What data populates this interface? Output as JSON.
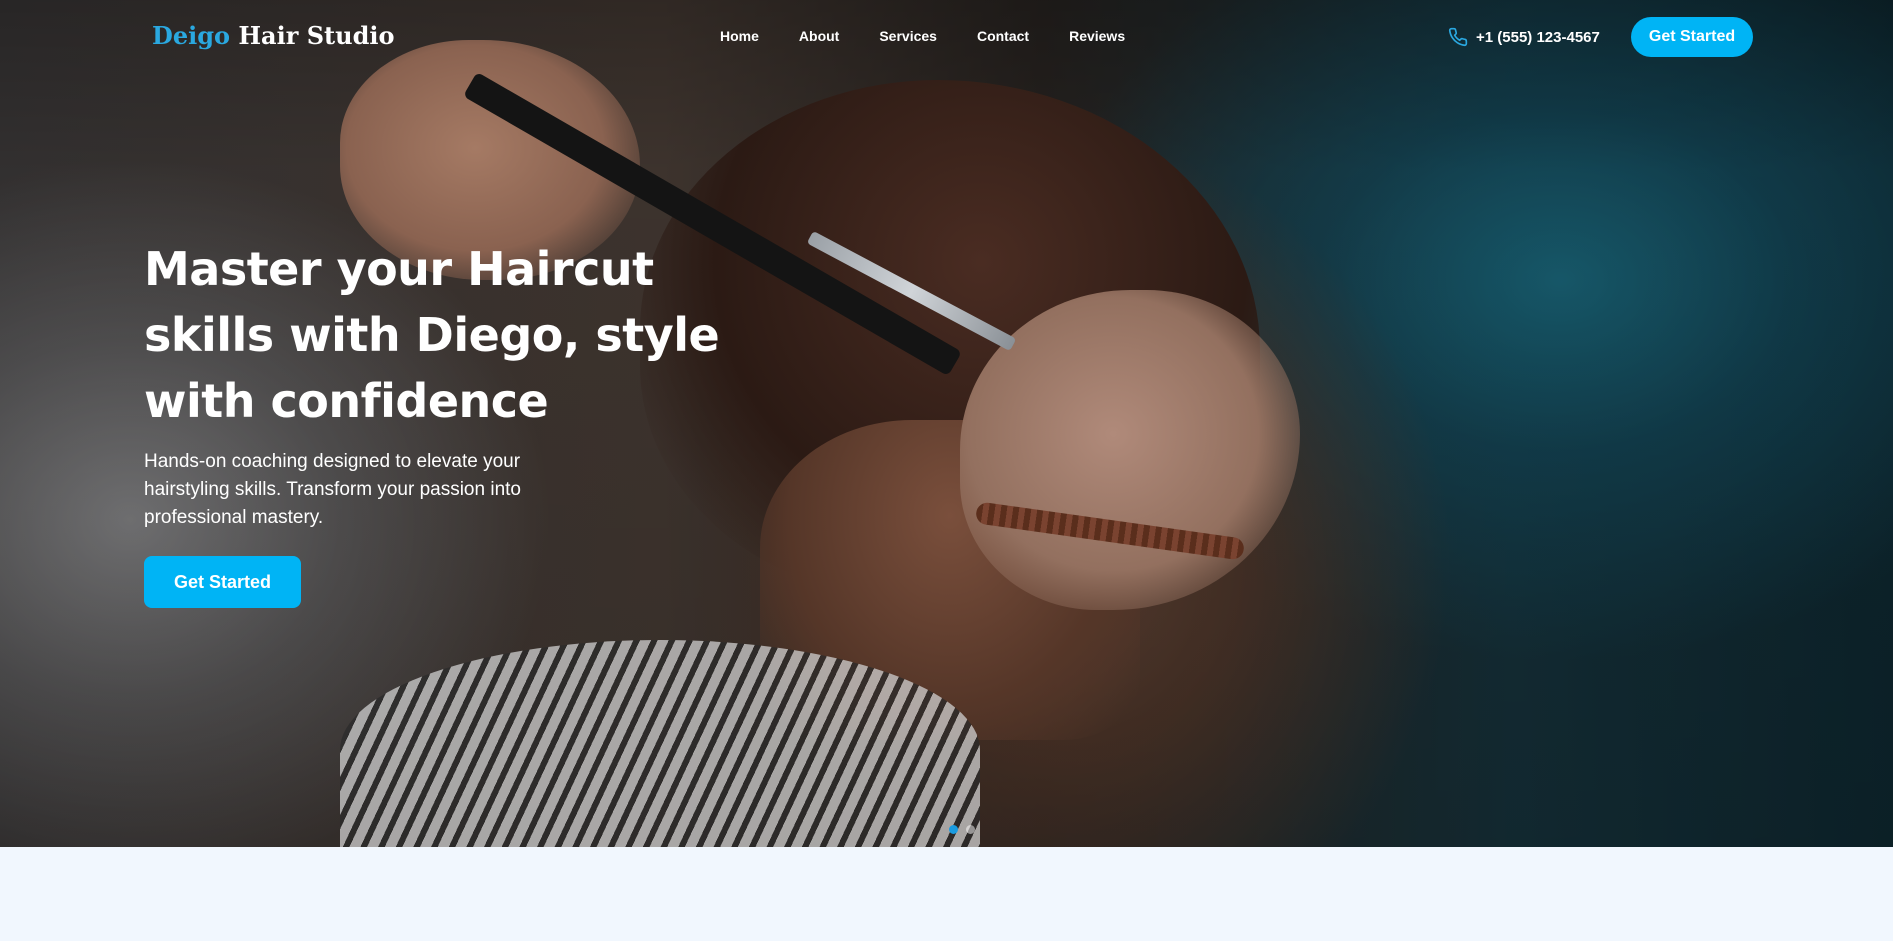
{
  "brand": {
    "accent_word": "Deigo",
    "rest": "Hair Studio",
    "accent_color": "#2aa8e0"
  },
  "nav": {
    "items": [
      {
        "label": "Home"
      },
      {
        "label": "About"
      },
      {
        "label": "Services"
      },
      {
        "label": "Contact"
      },
      {
        "label": "Reviews"
      }
    ]
  },
  "header": {
    "phone": "+1 (555) 123-4567",
    "phone_icon": "phone-icon",
    "cta_label": "Get Started"
  },
  "hero": {
    "title": "Master your Haircut skills with Diego, style with confidence",
    "subtitle": "Hands-on coaching designed to elevate your hairstyling skills. Transform your passion into professional mastery.",
    "cta_label": "Get Started",
    "slides_total": 2,
    "active_slide": 1
  },
  "colors": {
    "primary": "#00b4f5",
    "page_background": "#f1f7fe"
  }
}
